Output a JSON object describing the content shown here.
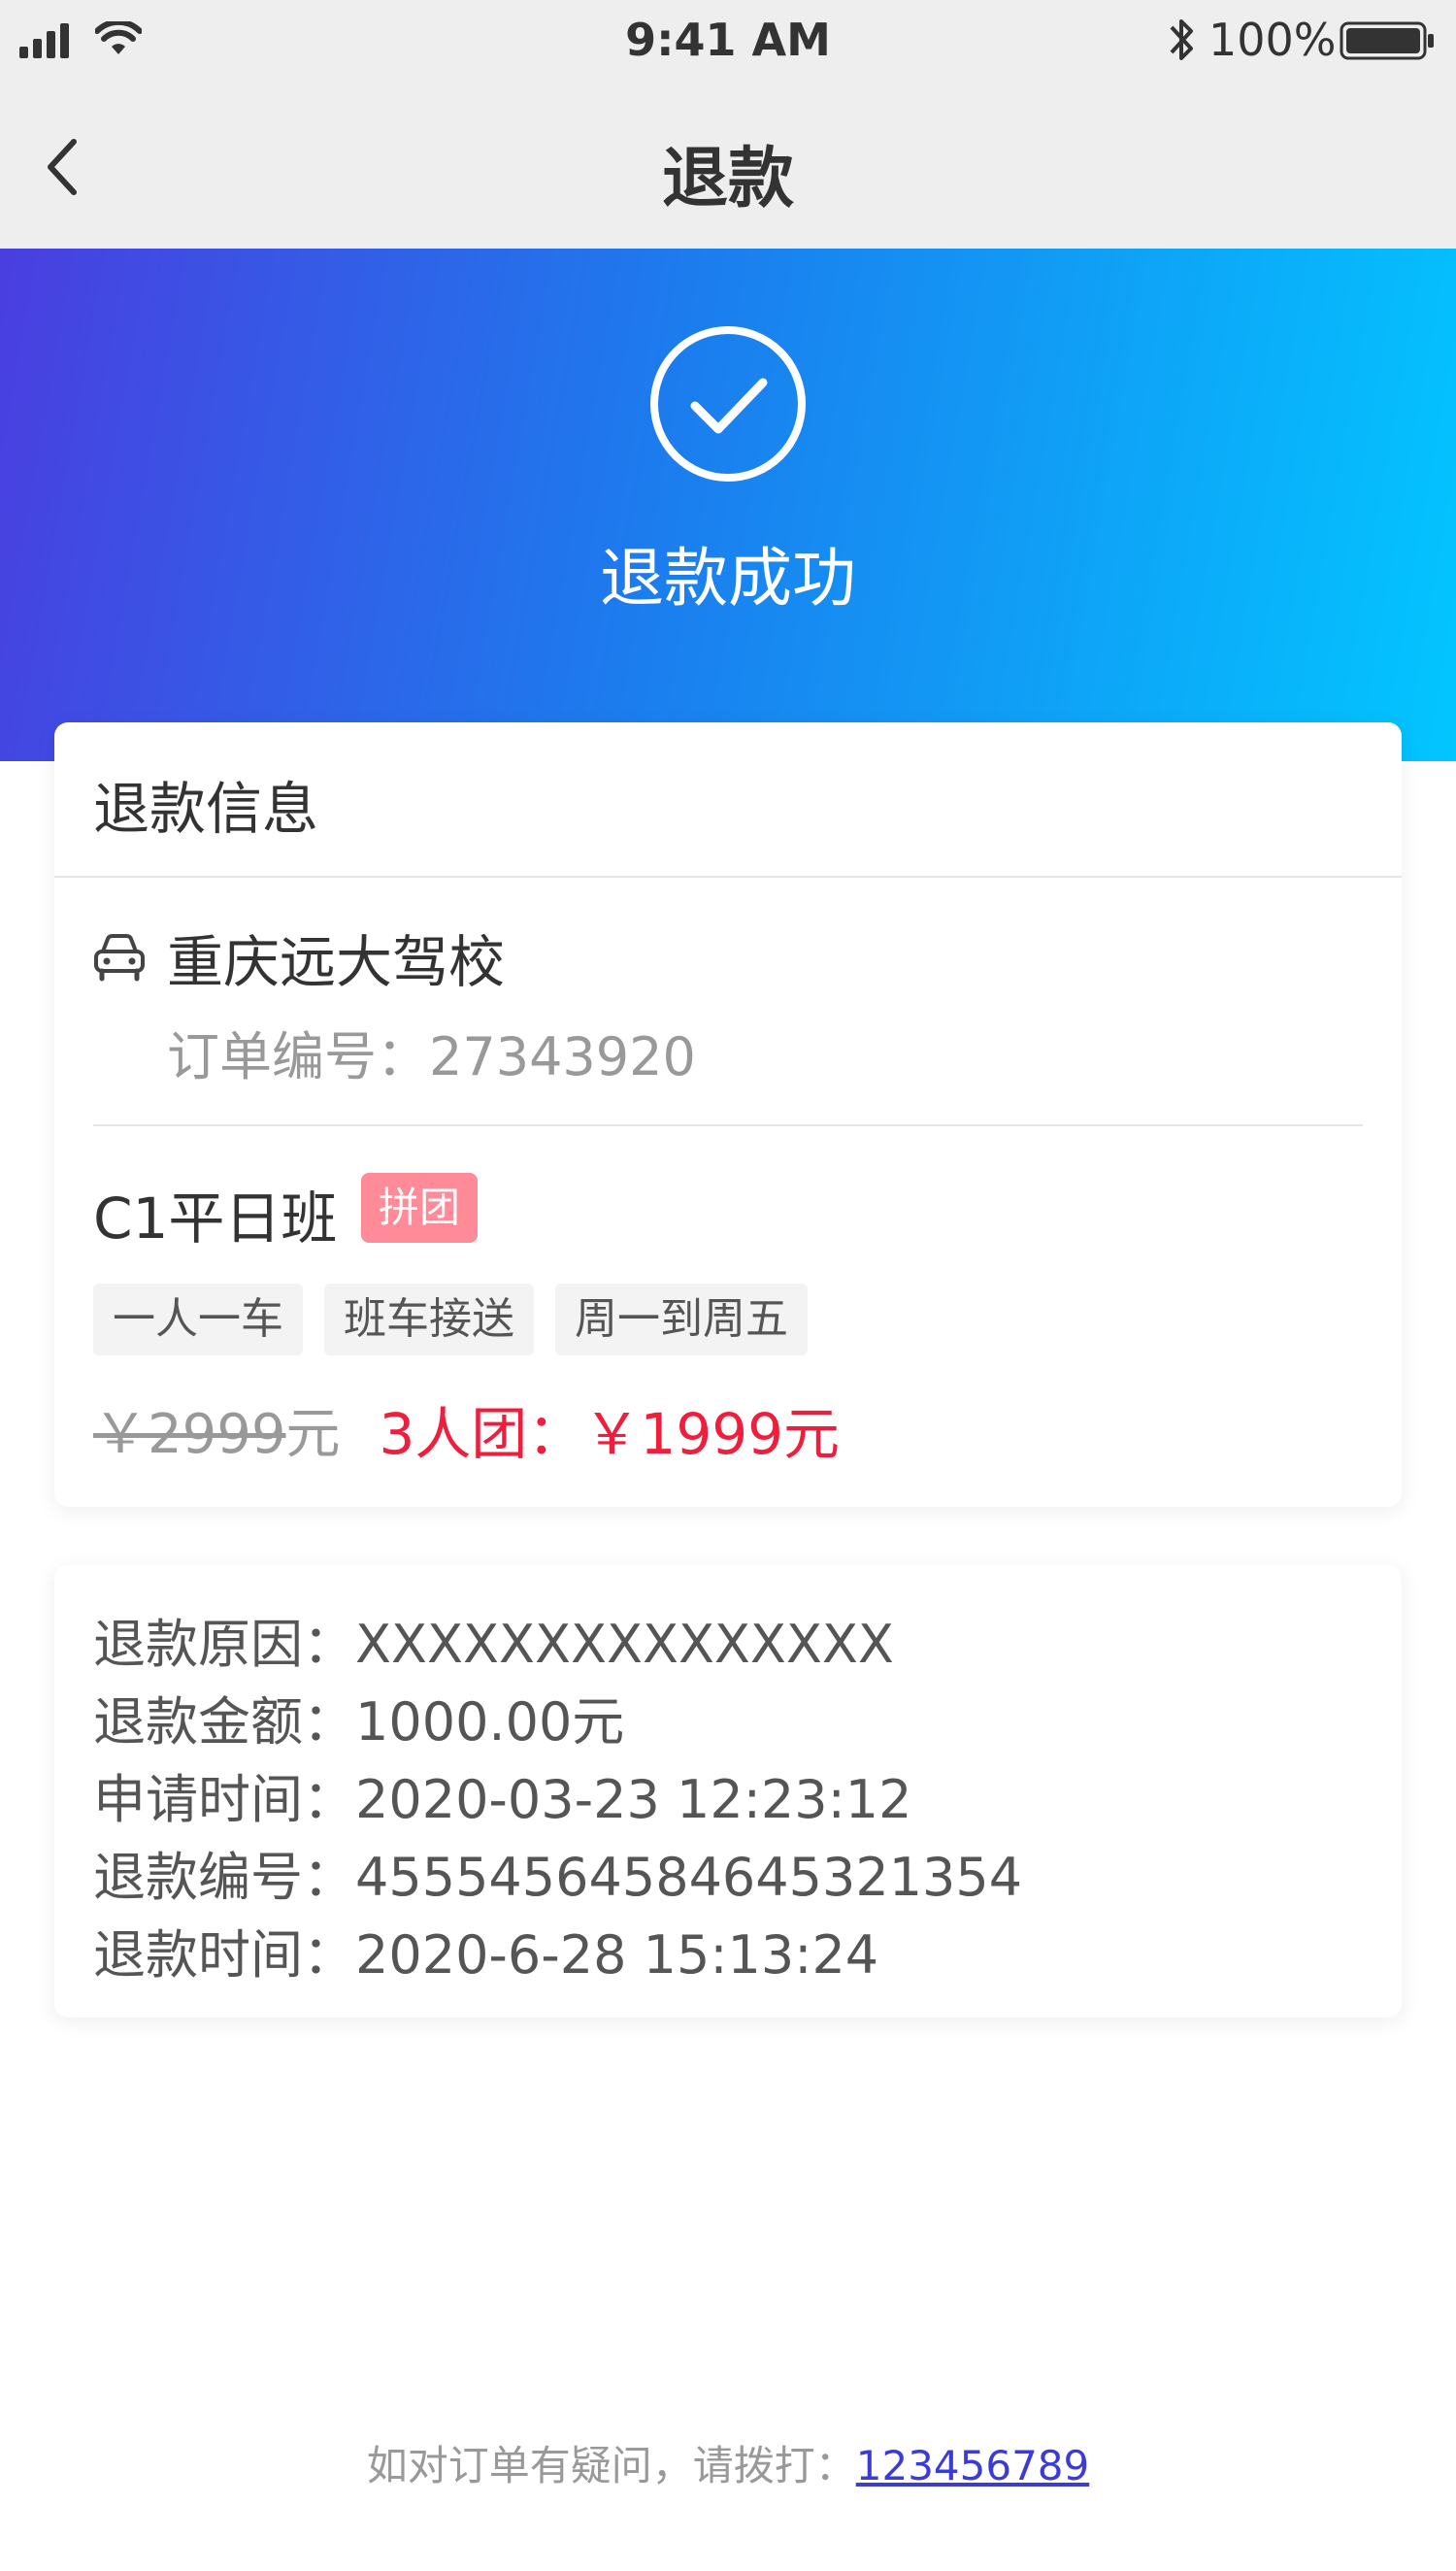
{
  "status_bar": {
    "time": "9:41 AM",
    "battery": "100%",
    "icons": [
      "signal-icon",
      "wifi-icon",
      "bluetooth-icon",
      "battery-icon"
    ]
  },
  "nav": {
    "title": "退款",
    "back_icon": "chevron-left-icon"
  },
  "hero": {
    "icon": "check-circle-icon",
    "title": "退款成功"
  },
  "info_card": {
    "title": "退款信息",
    "school_icon": "car-icon",
    "school_name": "重庆远大驾校",
    "order_no": "订单编号：27343920",
    "class_name": "C1平日班",
    "badge": "拼团",
    "tags": [
      "一人一车",
      "班车接送",
      "周一到周五"
    ],
    "original_price": "￥2999",
    "original_unit": "元",
    "group_price": "3人团：￥1999元"
  },
  "detail_card": {
    "rows": [
      "退款原因：XXXXXXXXXXXXXXX",
      "退款金额：1000.00元",
      "申请时间：2020-03-23 12:23:12",
      "退款编号：4555456458464532135​4",
      "退款时间：2020-6-28 15:13:24"
    ]
  },
  "footer": {
    "text": "如对订单有疑问，请拨打：",
    "phone": "123456789"
  },
  "colors": {
    "gradient_start": "#4a3ee0",
    "gradient_end": "#02c6ff",
    "accent_red": "#ee1e3c",
    "badge_pink": "#ff8a98",
    "link_blue": "#3b3bd8"
  }
}
